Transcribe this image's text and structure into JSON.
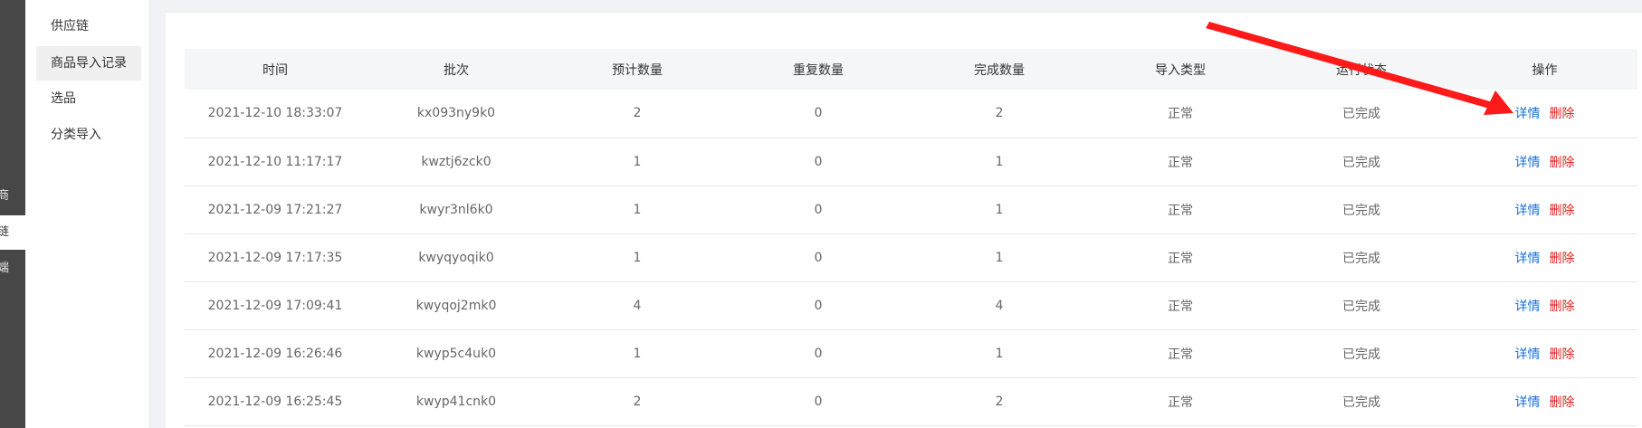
{
  "rail": {
    "items": [
      {
        "label": "商",
        "active": false
      },
      {
        "label": "链",
        "active": true
      },
      {
        "label": "端",
        "active": false
      }
    ]
  },
  "sub_sidebar": {
    "items": [
      {
        "label": "供应链",
        "active": false
      },
      {
        "label": "商品导入记录",
        "active": true
      },
      {
        "label": "选品",
        "active": false
      },
      {
        "label": "分类导入",
        "active": false
      }
    ]
  },
  "table": {
    "headers": [
      "时间",
      "批次",
      "预计数量",
      "重复数量",
      "完成数量",
      "导入类型",
      "运行状态",
      "操作"
    ],
    "rows": [
      {
        "time": "2021-12-10 18:33:07",
        "batch": "kx093ny9k0",
        "expected": "2",
        "duplicate": "0",
        "completed": "2",
        "type": "正常",
        "status": "已完成"
      },
      {
        "time": "2021-12-10 11:17:17",
        "batch": "kwztj6zck0",
        "expected": "1",
        "duplicate": "0",
        "completed": "1",
        "type": "正常",
        "status": "已完成"
      },
      {
        "time": "2021-12-09 17:21:27",
        "batch": "kwyr3nl6k0",
        "expected": "1",
        "duplicate": "0",
        "completed": "1",
        "type": "正常",
        "status": "已完成"
      },
      {
        "time": "2021-12-09 17:17:35",
        "batch": "kwyqyoqik0",
        "expected": "1",
        "duplicate": "0",
        "completed": "1",
        "type": "正常",
        "status": "已完成"
      },
      {
        "time": "2021-12-09 17:09:41",
        "batch": "kwyqoj2mk0",
        "expected": "4",
        "duplicate": "0",
        "completed": "4",
        "type": "正常",
        "status": "已完成"
      },
      {
        "time": "2021-12-09 16:26:46",
        "batch": "kwyp5c4uk0",
        "expected": "1",
        "duplicate": "0",
        "completed": "1",
        "type": "正常",
        "status": "已完成"
      },
      {
        "time": "2021-12-09 16:25:45",
        "batch": "kwyp41cnk0",
        "expected": "2",
        "duplicate": "0",
        "completed": "2",
        "type": "正常",
        "status": "已完成"
      }
    ],
    "actions": {
      "detail": "详情",
      "delete": "删除"
    }
  },
  "colors": {
    "link": "#1b6fd6",
    "danger": "#e02020",
    "annotation_arrow": "#ff1a1a"
  }
}
